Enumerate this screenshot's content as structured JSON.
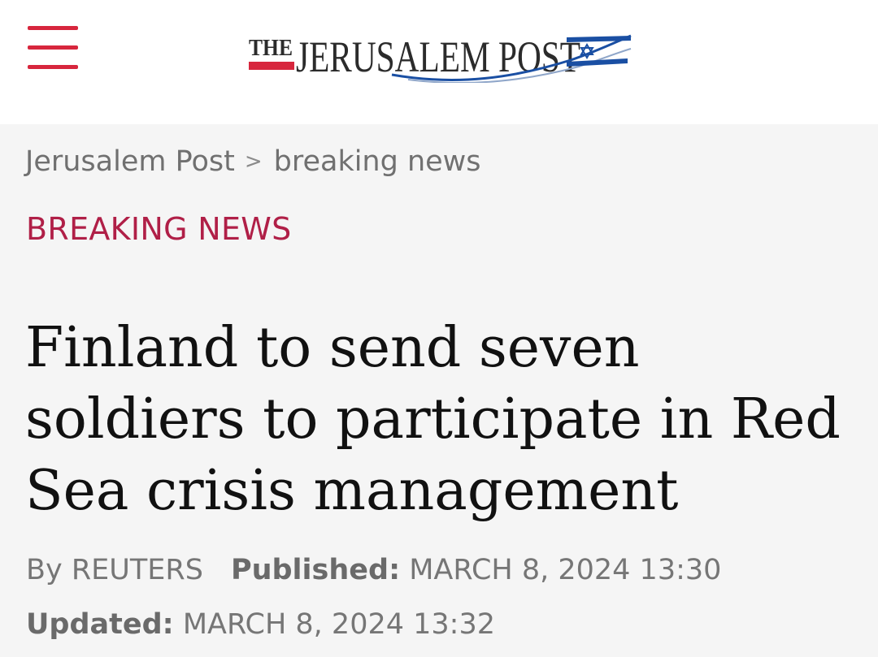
{
  "header": {
    "menu_icon": "hamburger-menu-icon",
    "logo": {
      "the": "THE",
      "name": "JERUSALEM POST",
      "flag_icon": "israel-flag-icon",
      "colors": {
        "red": "#d7263d",
        "text": "#2b2b2b",
        "blue": "#1a4fa3"
      }
    }
  },
  "breadcrumb": {
    "home": "Jerusalem Post",
    "separator": ">",
    "current": "breaking news"
  },
  "category": "BREAKING NEWS",
  "headline": "Finland to send seven soldiers to participate in Red Sea crisis management",
  "meta": {
    "byline": "By REUTERS",
    "published_label": "Published:",
    "published_value": "MARCH 8, 2024 13:30",
    "updated_label": "Updated:",
    "updated_value": "MARCH 8, 2024 13:32"
  },
  "colors": {
    "accent": "#d7263d",
    "category": "#b01f47",
    "background": "#f5f5f5"
  }
}
